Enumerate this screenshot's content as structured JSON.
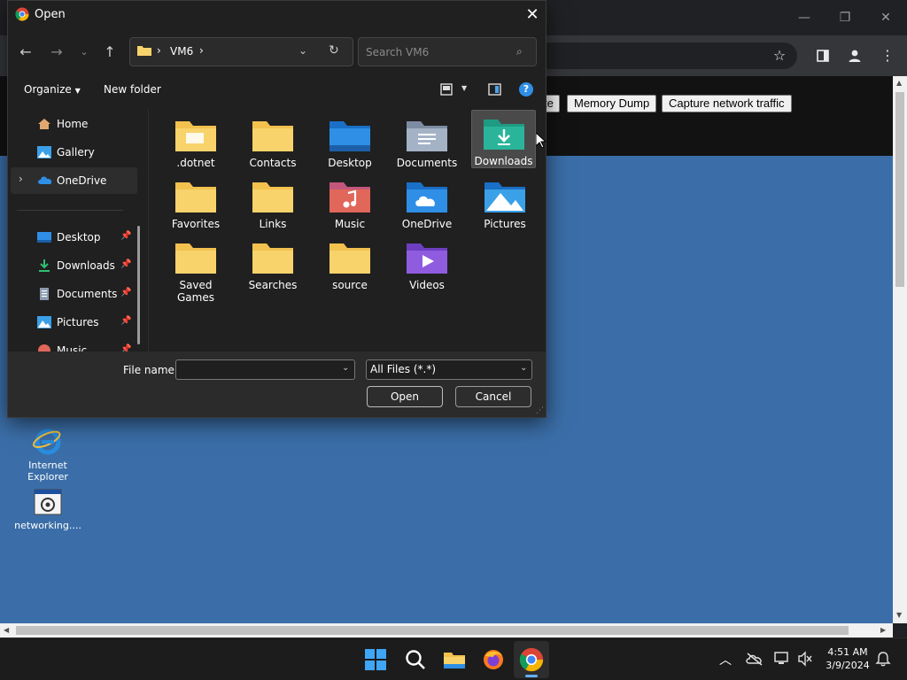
{
  "dialog": {
    "title": "Open",
    "address": {
      "segment": "VM6"
    },
    "search_placeholder": "Search VM6",
    "organize_label": "Organize",
    "new_folder_label": "New folder",
    "nav_items": [
      {
        "label": "Home",
        "icon": "home-icon"
      },
      {
        "label": "Gallery",
        "icon": "gallery-icon"
      },
      {
        "label": "OneDrive",
        "icon": "onedrive-icon"
      },
      {
        "label": "Desktop",
        "icon": "desktop-icon"
      },
      {
        "label": "Downloads",
        "icon": "downloads-icon"
      },
      {
        "label": "Documents",
        "icon": "documents-icon"
      },
      {
        "label": "Pictures",
        "icon": "pictures-icon"
      },
      {
        "label": "Music",
        "icon": "music-icon"
      }
    ],
    "files": [
      {
        "label": ".dotnet",
        "kind": "folder"
      },
      {
        "label": "Contacts",
        "kind": "folder"
      },
      {
        "label": "Desktop",
        "kind": "desktop"
      },
      {
        "label": "Documents",
        "kind": "documents"
      },
      {
        "label": "Downloads",
        "kind": "downloads",
        "selected": true
      },
      {
        "label": "Favorites",
        "kind": "folder"
      },
      {
        "label": "Links",
        "kind": "folder"
      },
      {
        "label": "Music",
        "kind": "music"
      },
      {
        "label": "OneDrive",
        "kind": "onedrive"
      },
      {
        "label": "Pictures",
        "kind": "pictures"
      },
      {
        "label": "Saved Games",
        "kind": "folder"
      },
      {
        "label": "Searches",
        "kind": "folder"
      },
      {
        "label": "source",
        "kind": "folder"
      },
      {
        "label": "Videos",
        "kind": "videos"
      }
    ],
    "file_name_label": "File name:",
    "file_name_value": "",
    "file_type": "All Files (*.*)",
    "open_label": "Open",
    "cancel_label": "Cancel"
  },
  "webpage": {
    "buttons": [
      {
        "label": "te"
      },
      {
        "label": "Memory Dump"
      },
      {
        "label": "Capture network traffic"
      }
    ]
  },
  "desktop_icons": [
    {
      "label_line1": "Internet",
      "label_line2": "Explorer"
    },
    {
      "label_line1": "networking....",
      "label_line2": ""
    }
  ],
  "clock": {
    "time": "4:51 AM",
    "date": "3/9/2024"
  },
  "colors": {
    "accent": "#0078d4",
    "folder": "#f8d36b",
    "desktop_bg": "#3b6ea8"
  }
}
